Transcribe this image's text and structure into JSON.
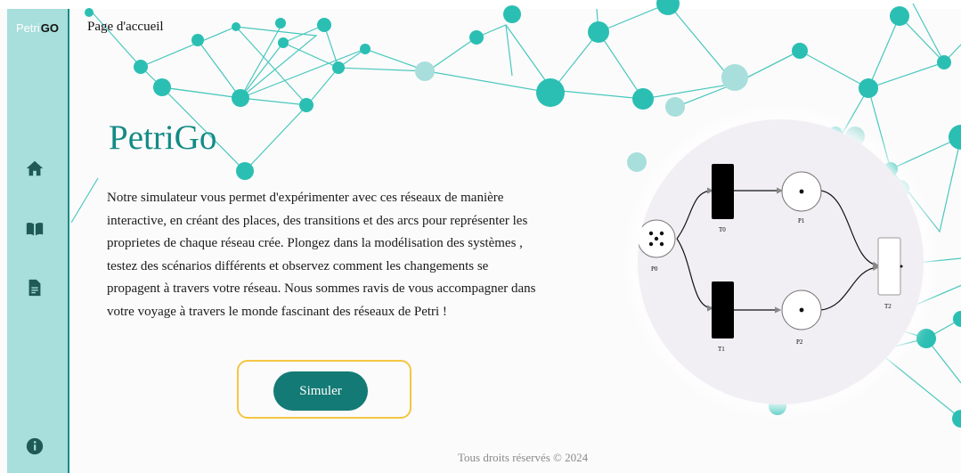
{
  "app": {
    "logo_prefix": "Petri",
    "logo_suffix": "GO"
  },
  "sidebar": {
    "items": [
      {
        "name": "home",
        "icon": "home-icon"
      },
      {
        "name": "docs",
        "icon": "book-icon"
      },
      {
        "name": "files",
        "icon": "document-icon"
      },
      {
        "name": "info",
        "icon": "info-icon"
      }
    ]
  },
  "header": {
    "breadcrumb": "Page d'accueil"
  },
  "main": {
    "title": "PetriGo",
    "description": "Notre simulateur vous permet d'expérimenter avec ces réseaux de manière interactive, en créant des places, des transitions et des arcs pour représenter les proprietes de chaque réseau crée. Plongez dans la modélisation des systèmes , testez des scénarios différents et observez comment les changements se propagent à travers votre réseau. Nous sommes ravis de vous accompagner dans votre voyage à travers le monde fascinant des réseaux de Petri !",
    "simulate_button": "Simuler"
  },
  "petri_net": {
    "places": [
      {
        "label": "P0",
        "tokens": 5
      },
      {
        "label": "P1",
        "tokens": 1
      },
      {
        "label": "P2",
        "tokens": 1
      }
    ],
    "transitions": [
      {
        "label": "T0",
        "enabled": true
      },
      {
        "label": "T1",
        "enabled": true
      },
      {
        "label": "T2",
        "enabled": false
      }
    ]
  },
  "footer": {
    "text": "Tous droits réservés © 2024"
  },
  "colors": {
    "accent": "#138b85",
    "sidebar": "#a8dedb",
    "node": "#2bbfb3",
    "focus": "#f5c542"
  }
}
